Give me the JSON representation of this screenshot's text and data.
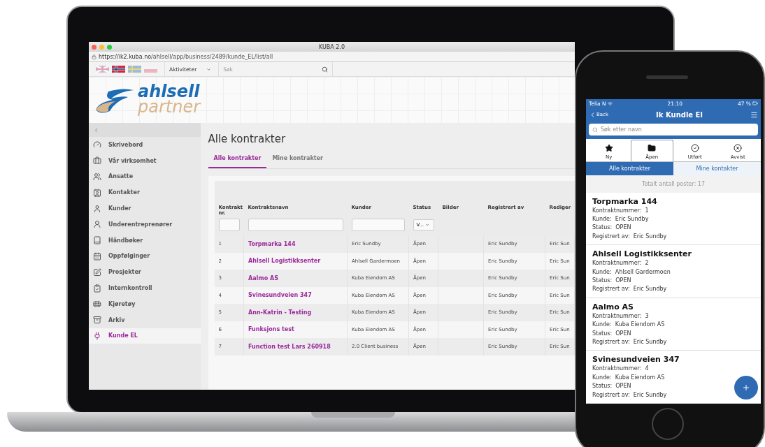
{
  "laptop": {
    "window_title": "KUBA 2.0",
    "url": {
      "host": "https://ik2.kuba.no",
      "path": "/ahlsell/app/business/2489/kunde_EL/list/all"
    },
    "toolbar": {
      "dropdown": "Aktiviteter",
      "search_placeholder": "Søk"
    },
    "logo": {
      "line_1": "ahlsell",
      "line_2": "partner"
    },
    "sidebar": {
      "items": [
        {
          "label": "Skrivebord",
          "selected": false
        },
        {
          "label": "Vår virksomhet",
          "selected": false
        },
        {
          "label": "Ansatte",
          "selected": false
        },
        {
          "label": "Kontakter",
          "selected": false
        },
        {
          "label": "Kunder",
          "selected": false
        },
        {
          "label": "Underentreprenører",
          "selected": false
        },
        {
          "label": "Håndbøker",
          "selected": false
        },
        {
          "label": "Oppfølginger",
          "selected": false
        },
        {
          "label": "Prosjekter",
          "selected": false
        },
        {
          "label": "Internkontroll",
          "selected": false
        },
        {
          "label": "Kjøretøy",
          "selected": false
        },
        {
          "label": "Arkiv",
          "selected": false
        },
        {
          "label": "Kunde EL",
          "selected": true
        }
      ]
    },
    "page_title": "Alle kontrakter",
    "tabs": [
      {
        "label": "Alle kontrakter",
        "selected": true
      },
      {
        "label": "Mine kontrakter",
        "selected": false
      }
    ],
    "table": {
      "columns": [
        "Kontrakt nr.",
        "Kontraktsnavn",
        "Kunder",
        "Status",
        "Bilder",
        "Registrert av",
        "Rediger"
      ],
      "status_filter": "V...",
      "rows": [
        {
          "nr": "1",
          "name": "Torpmarka 144",
          "customer": "Eric Sundby",
          "status": "Åpen",
          "registered_by": "Eric Sundby",
          "column_7": "Eric Sun"
        },
        {
          "nr": "2",
          "name": "Ahlsell Logistikksenter",
          "customer": "Ahlsell Gardermoen",
          "status": "Åpen",
          "registered_by": "Eric Sundby",
          "column_7": "Eric Sun"
        },
        {
          "nr": "3",
          "name": "Aalmo AS",
          "customer": "Kuba Eiendom AS",
          "status": "Åpen",
          "registered_by": "Eric Sundby",
          "column_7": "Eric Sun"
        },
        {
          "nr": "4",
          "name": "Svinesundveien 347",
          "customer": "Kuba Eiendom AS",
          "status": "Åpen",
          "registered_by": "Eric Sundby",
          "column_7": "Eric Sun"
        },
        {
          "nr": "5",
          "name": "Ann-Katrin - Testing",
          "customer": "Kuba Eiendom AS",
          "status": "Åpen",
          "registered_by": "Eric Sundby",
          "column_7": "Eric Sun"
        },
        {
          "nr": "6",
          "name": "Funksjons test",
          "customer": "Kuba Eiendom AS",
          "status": "Åpen",
          "registered_by": "Eric Sundby",
          "column_7": "Eric Sun"
        },
        {
          "nr": "7",
          "name": "Function test Lars 260918",
          "customer": "2.0 Client business",
          "status": "Åpen",
          "registered_by": "Eric Sundby",
          "column_7": "Eric Sun"
        }
      ]
    }
  },
  "phone": {
    "status_bar": {
      "carrier": "Telia N",
      "time": "21:10",
      "battery": "47 %"
    },
    "header": {
      "back": "Back",
      "title": "Ik Kundle El"
    },
    "search_placeholder": "Søk etter navn",
    "status_tabs": [
      {
        "label": "Ny",
        "selected": false
      },
      {
        "label": "Åpen",
        "selected": true
      },
      {
        "label": "Utført",
        "selected": false
      },
      {
        "label": "Avvist",
        "selected": false
      }
    ],
    "segments": [
      {
        "label": "Alle kontrakter",
        "selected": true
      },
      {
        "label": "Mine kontakter",
        "selected": false
      }
    ],
    "total": "Totalt antall poster: 17",
    "cards": [
      {
        "title": "Torpmarka 144",
        "fields": [
          {
            "label": "Kontraktnummer:",
            "value": "1"
          },
          {
            "label": "Kunde:",
            "value": "Eric Sundby"
          },
          {
            "label": "Status:",
            "value": "OPEN"
          },
          {
            "label": "Registrert av:",
            "value": "Eric Sundby"
          }
        ]
      },
      {
        "title": "Ahlsell Logistikksenter",
        "fields": [
          {
            "label": "Kontraktnummer:",
            "value": "2"
          },
          {
            "label": "Kunde:",
            "value": "Ahlsell Gardermoen"
          },
          {
            "label": "Status:",
            "value": "OPEN"
          },
          {
            "label": "Registrert av:",
            "value": "Eric Sundby"
          }
        ]
      },
      {
        "title": "Aalmo AS",
        "fields": [
          {
            "label": "Kontraktnummer:",
            "value": "3"
          },
          {
            "label": "Kunde:",
            "value": "Kuba Eiendom AS"
          },
          {
            "label": "Status:",
            "value": "OPEN"
          },
          {
            "label": "Registrert av:",
            "value": "Eric Sundby"
          }
        ]
      },
      {
        "title": "Svinesundveien 347",
        "fields": [
          {
            "label": "Kontraktnummer:",
            "value": "4"
          },
          {
            "label": "Kunde:",
            "value": "Kuba Eiendom AS"
          },
          {
            "label": "Status:",
            "value": "OPEN"
          },
          {
            "label": "Registrert av:",
            "value": "Eric Sundby"
          }
        ]
      }
    ]
  }
}
